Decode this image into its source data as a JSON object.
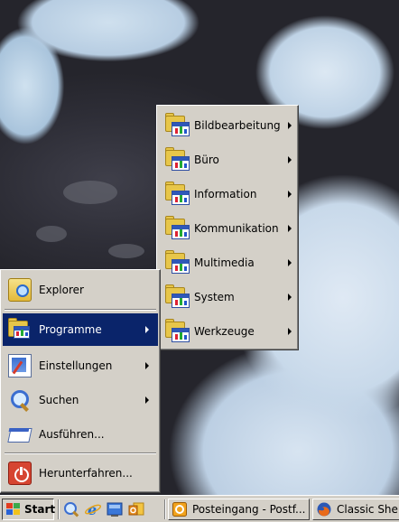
{
  "start_menu": {
    "items": [
      {
        "label": "Explorer",
        "icon": "explorer-icon"
      },
      {
        "label": "Programme",
        "icon": "programs-icon",
        "active": true
      },
      {
        "label": "Einstellungen",
        "icon": "settings-icon"
      },
      {
        "label": "Suchen",
        "icon": "search-icon"
      },
      {
        "label": "Ausführen...",
        "icon": "run-icon"
      },
      {
        "label": "Herunterfahren...",
        "icon": "shutdown-icon"
      }
    ]
  },
  "submenu": {
    "items": [
      {
        "label": "Bildbearbeitung"
      },
      {
        "label": "Büro"
      },
      {
        "label": "Information"
      },
      {
        "label": "Kommunikation"
      },
      {
        "label": "Multimedia"
      },
      {
        "label": "System"
      },
      {
        "label": "Werkzeuge"
      }
    ]
  },
  "taskbar": {
    "start_label": "Start",
    "tasks": [
      {
        "label": "Posteingang - Postf...",
        "icon": "mail-icon"
      },
      {
        "label": "Classic She",
        "icon": "firefox-icon"
      }
    ]
  },
  "colors": {
    "menu_bg": "#d4d0c8",
    "highlight": "#0a246a",
    "highlight_text": "#ffffff"
  }
}
